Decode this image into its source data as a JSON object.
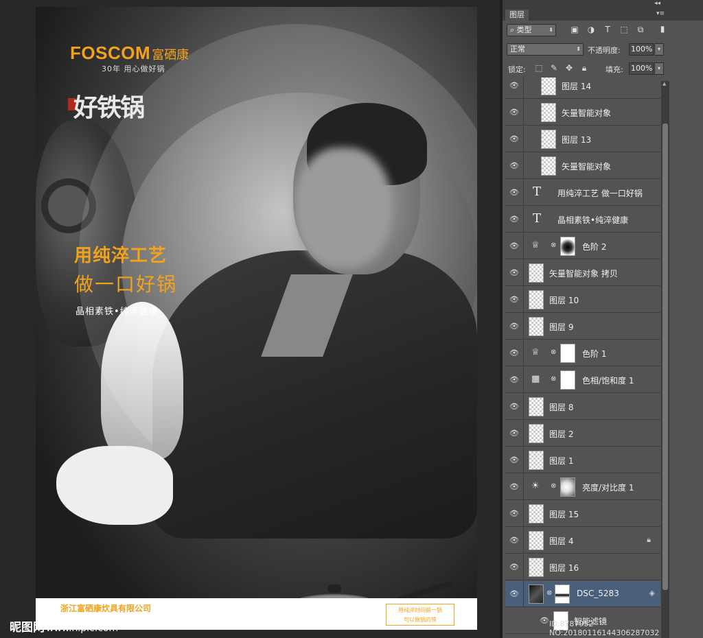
{
  "poster": {
    "brand": "FOSCOM",
    "brand_cn": "富硒康",
    "tagline": "30年 用心做好锅",
    "calligraphy": "好铁锅",
    "headline_1": "用纯淬工艺",
    "headline_2": "做一口好锅",
    "subline": "晶相素铁•纯淬健康",
    "footer_company": "浙江富硒康炊具有限公司",
    "footer_slogan_1": "用纯淬时间锻一锅",
    "footer_slogan_2": "可以做锅的铁"
  },
  "watermark": {
    "site": "昵图网",
    "url": "www.nipic.com"
  },
  "image_id": "ID:8787952 NO:20180116144306287032",
  "panel": {
    "tab": "图层",
    "filter_kind": "类型",
    "blend_mode": "正常",
    "opacity_label": "不透明度:",
    "opacity_value": "100%",
    "lock_label": "锁定:",
    "fill_label": "填充:",
    "fill_value": "100%",
    "layers": [
      {
        "name": "图层 14",
        "type": "pixel"
      },
      {
        "name": "矢量智能对象",
        "type": "pixel"
      },
      {
        "name": "图层 13",
        "type": "pixel"
      },
      {
        "name": "矢量智能对象",
        "type": "pixel"
      },
      {
        "name": "用纯淬工艺 做一口好锅",
        "type": "text"
      },
      {
        "name": "晶相素铁•纯淬健康",
        "type": "text"
      },
      {
        "name": "色阶 2",
        "type": "levels"
      },
      {
        "name": "矢量智能对象 拷贝",
        "type": "pixel"
      },
      {
        "name": "图层 10",
        "type": "pixel"
      },
      {
        "name": "图层 9",
        "type": "pixel"
      },
      {
        "name": "色阶 1",
        "type": "levels"
      },
      {
        "name": "色相/饱和度 1",
        "type": "huesat"
      },
      {
        "name": "图层 8",
        "type": "pixel"
      },
      {
        "name": "图层 2",
        "type": "pixel"
      },
      {
        "name": "图层 1",
        "type": "pixel"
      },
      {
        "name": "亮度/对比度 1",
        "type": "brightness"
      },
      {
        "name": "图层 15",
        "type": "pixel"
      },
      {
        "name": "图层 4",
        "type": "pixel",
        "locked": true
      },
      {
        "name": "图层 16",
        "type": "pixel"
      },
      {
        "name": "DSC_5283",
        "type": "smart",
        "selected": true
      },
      {
        "name": "智能滤镜",
        "type": "filter"
      }
    ]
  }
}
